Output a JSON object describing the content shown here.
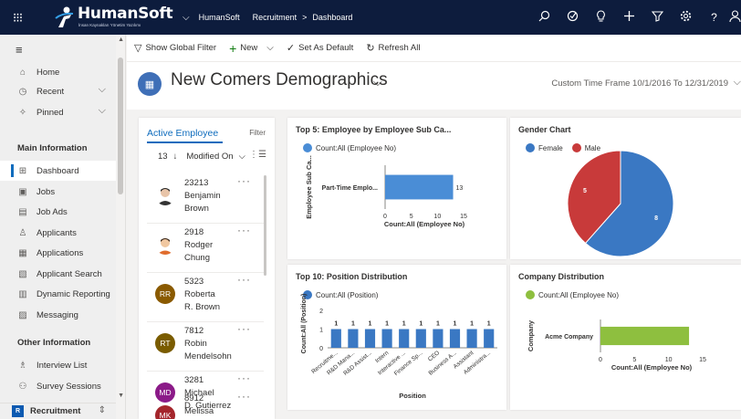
{
  "topbar": {
    "logo_text": "HumanSoft",
    "logo_sub": "İnsan Kaynakları Yönetim Yazılımı",
    "app_name": "HumanSoft",
    "breadcrumb_area": "Recruitment",
    "breadcrumb_sep": ">",
    "breadcrumb_page": "Dashboard"
  },
  "leftnav": {
    "home": "Home",
    "recent": "Recent",
    "pinned": "Pinned",
    "main_header": "Main Information",
    "main_items": [
      "Dashboard",
      "Jobs",
      "Job Ads",
      "Applicants",
      "Applications",
      "Applicant Search",
      "Dynamic Reporting",
      "Messaging"
    ],
    "other_header": "Other Information",
    "other_items": [
      "Interview List",
      "Survey Sessions"
    ],
    "area_badge": "R",
    "area_label": "Recruitment"
  },
  "cmdbar": {
    "show_filter": "Show Global Filter",
    "new": "New",
    "set_default": "Set As Default",
    "refresh": "Refresh All"
  },
  "header": {
    "title": "New Comers Demographics",
    "time_frame": "Custom Time Frame 10/1/2016 To 12/31/2019"
  },
  "active_employee": {
    "title": "Active Employee",
    "filter": "Filter",
    "count": "13",
    "sort_field": "Modified On",
    "items": [
      {
        "id": "23213",
        "first": "Benjamin",
        "last": "Brown",
        "initials": "",
        "color": "#ffffff"
      },
      {
        "id": "2918",
        "first": "Rodger",
        "last": "Chung",
        "initials": "",
        "color": "#ffffff"
      },
      {
        "id": "5323",
        "first": "Roberta",
        "last": "R. Brown",
        "initials": "RR",
        "color": "#8a5a00"
      },
      {
        "id": "7812",
        "first": "Robin",
        "last": "Mendelsohn",
        "initials": "RT",
        "color": "#7a5c00"
      },
      {
        "id": "3281",
        "first": "Michael",
        "last": "D. Gutierrez",
        "initials": "MD",
        "color": "#8b1a88"
      },
      {
        "id": "8912",
        "first": "Melissa",
        "last": "",
        "initials": "MK",
        "color": "#a4262c"
      }
    ]
  },
  "charts": {
    "c1_title": "Top 5: Employee by Employee Sub Ca...",
    "c1_legend": "Count:All (Employee No)",
    "c2_title": "Gender Chart",
    "c2_legend_a": "Female",
    "c2_legend_b": "Male",
    "c3_title": "Top 10: Position Distribution",
    "c3_legend": "Count:All (Position)",
    "c4_title": "Company Distribution",
    "c4_legend": "Count:All (Employee No)"
  },
  "chart_data": [
    {
      "type": "bar",
      "orientation": "horizontal",
      "title": "Top 5: Employee by Employee Sub Ca...",
      "categories": [
        "Part-Time Emplo..."
      ],
      "series": [
        {
          "name": "Count:All (Employee No)",
          "values": [
            13
          ],
          "color": "#4a8dd6"
        }
      ],
      "xlabel": "Count:All (Employee No)",
      "ylabel": "Employee Sub Ca...",
      "xlim": [
        0,
        15
      ],
      "xticks": [
        0,
        5,
        10,
        15
      ],
      "data_labels": true
    },
    {
      "type": "pie",
      "title": "Gender Chart",
      "categories": [
        "Female",
        "Male"
      ],
      "values": [
        8,
        5
      ],
      "labels": [
        "8",
        "5"
      ],
      "colors": [
        "#3a78c3",
        "#c83a3a"
      ]
    },
    {
      "type": "bar",
      "title": "Top 10: Position Distribution",
      "categories": [
        "Recruitme...",
        "R&D Mana...",
        "R&D Assist...",
        "Intern",
        "Interactive ...",
        "Finance Sp...",
        "CEO",
        "Business A...",
        "Assistant",
        "Administra..."
      ],
      "series": [
        {
          "name": "Count:All (Position)",
          "values": [
            1,
            1,
            1,
            1,
            1,
            1,
            1,
            1,
            1,
            1
          ],
          "color": "#3a78c3"
        }
      ],
      "xlabel": "Position",
      "ylabel": "Count:All (Position)",
      "ylim": [
        0,
        2
      ],
      "yticks": [
        0,
        1,
        2
      ],
      "data_labels": true
    },
    {
      "type": "bar",
      "orientation": "horizontal",
      "title": "Company Distribution",
      "categories": [
        "Acme Company"
      ],
      "series": [
        {
          "name": "Count:All (Employee No)",
          "values": [
            13
          ],
          "color": "#8ebf3f"
        }
      ],
      "xlabel": "Count:All (Employee No)",
      "ylabel": "Company",
      "xlim": [
        0,
        15
      ],
      "xticks": [
        0,
        5,
        10,
        15
      ]
    }
  ]
}
